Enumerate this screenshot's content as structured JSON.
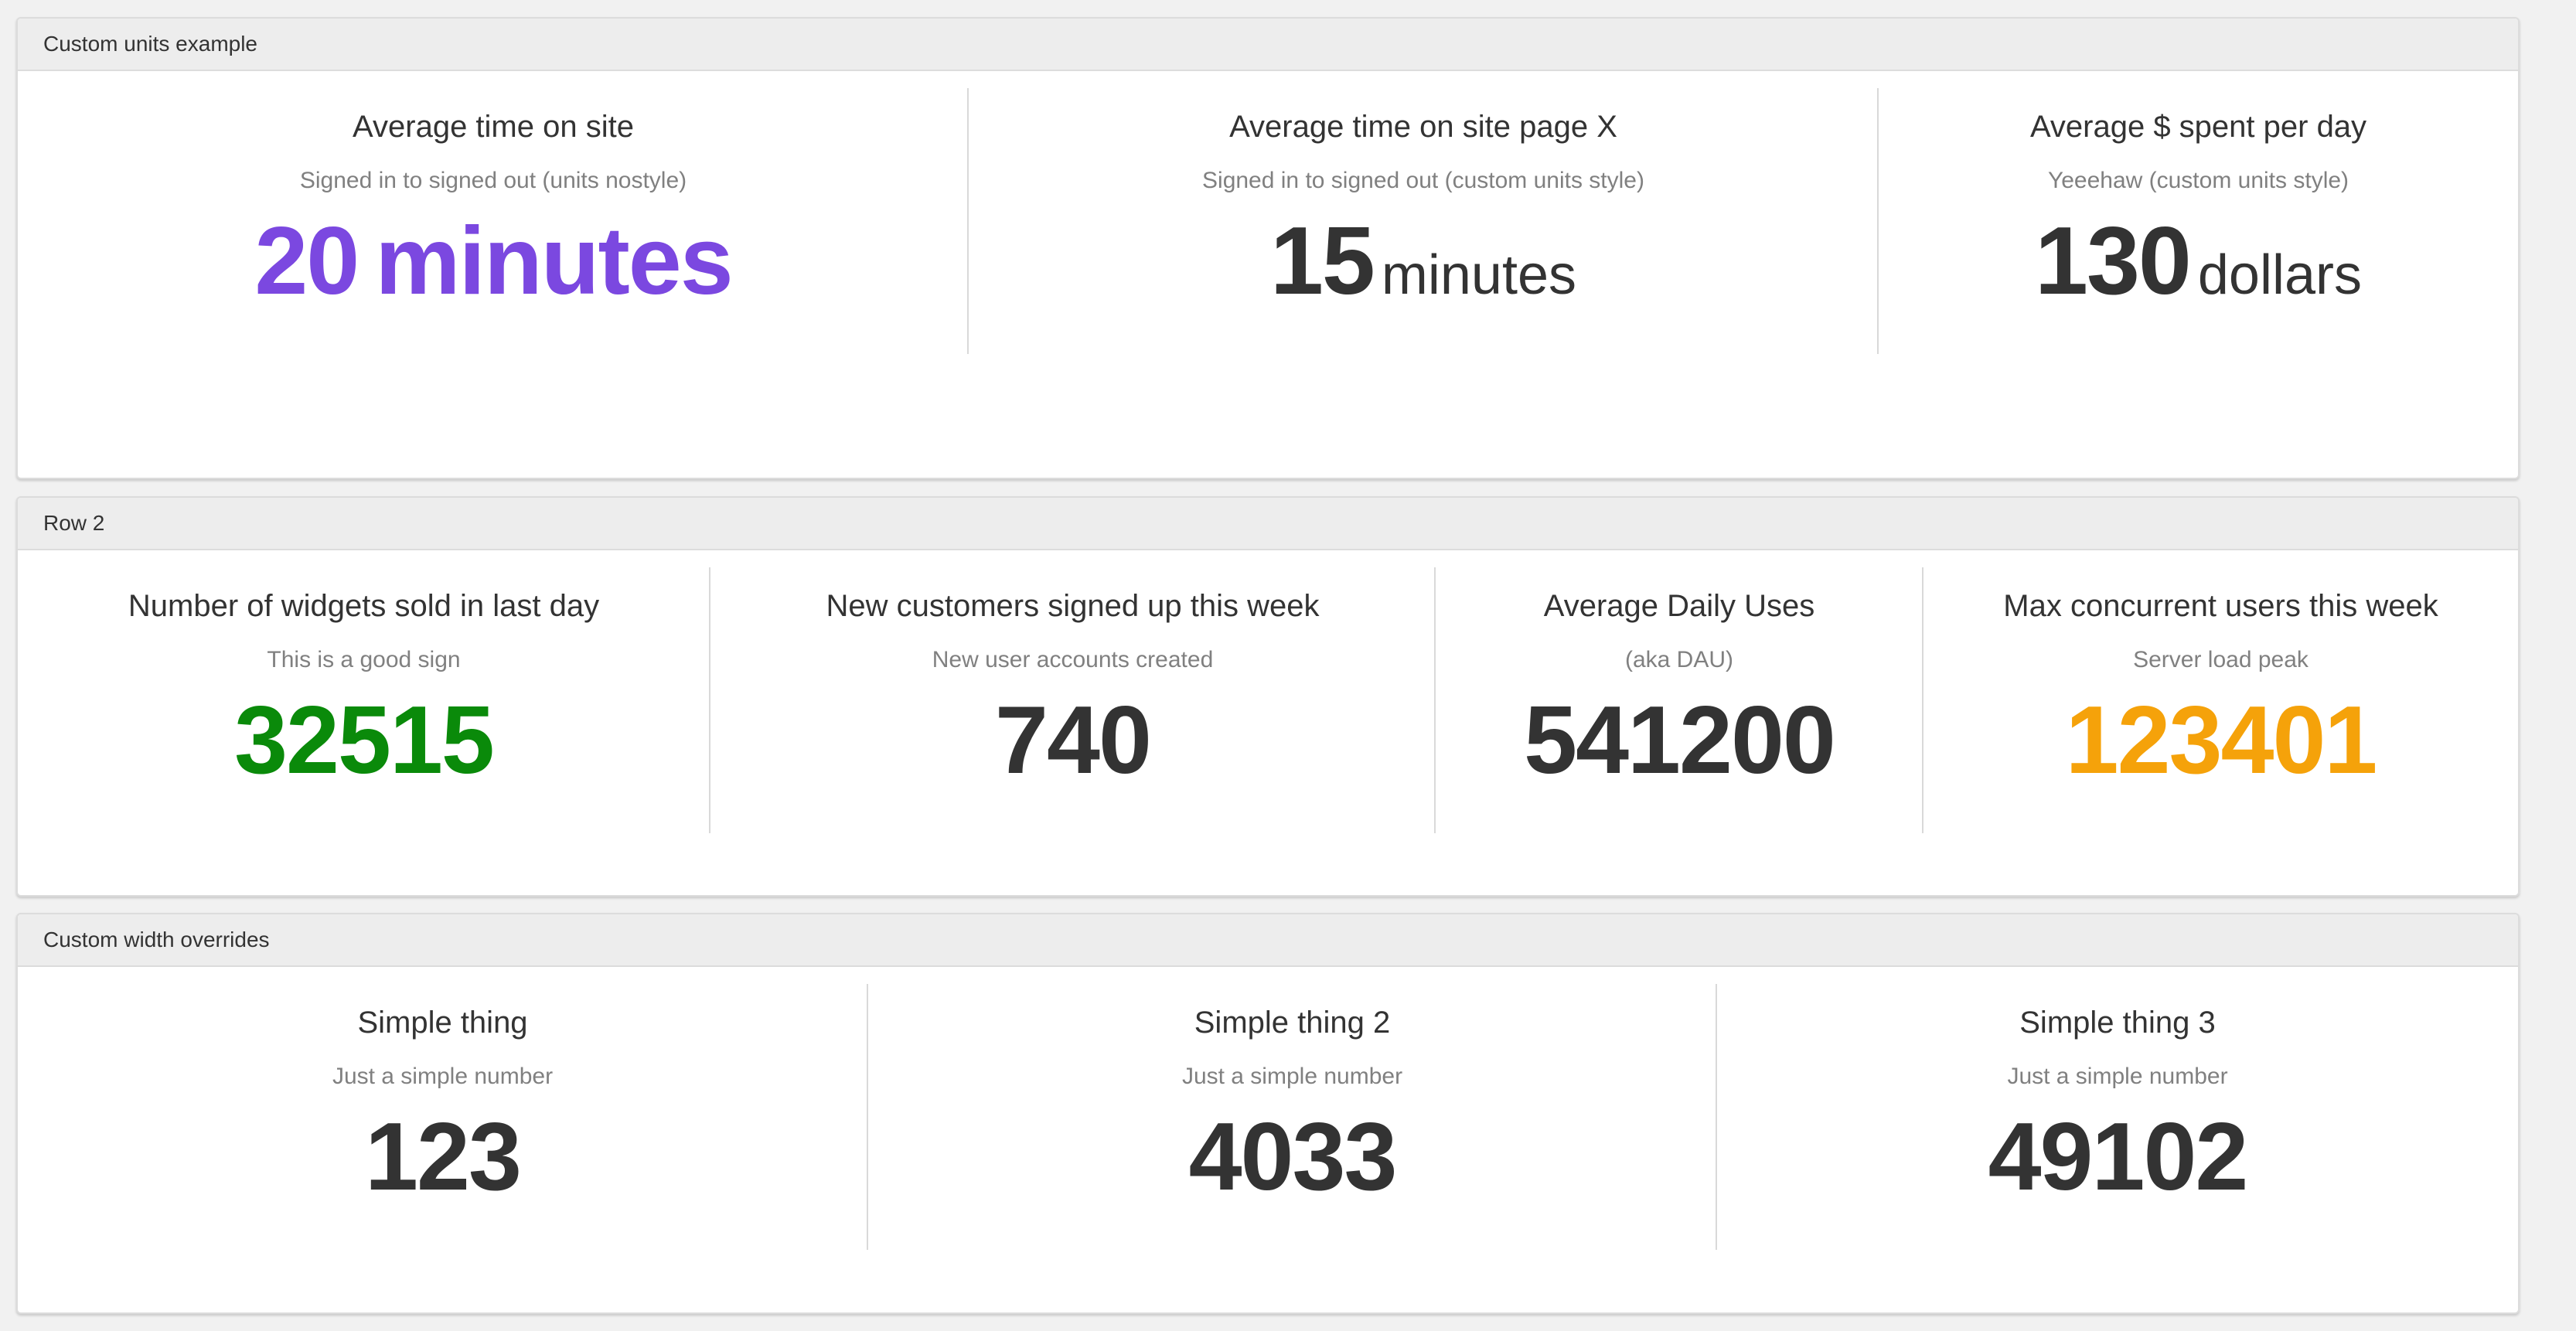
{
  "panels": [
    {
      "title": "Custom units example",
      "widgets": [
        {
          "title": "Average time on site",
          "subtitle": "Signed in to signed out (units nostyle)",
          "value": "20",
          "units": "minutes",
          "color": "#7b48e0"
        },
        {
          "title": "Average time on site page X",
          "subtitle": "Signed in to signed out (custom units style)",
          "value": "15",
          "units": "minutes",
          "color": "#333333"
        },
        {
          "title": "Average $ spent per day",
          "subtitle": "Yeeehaw (custom units style)",
          "value": "130",
          "units": "dollars",
          "color": "#333333"
        }
      ]
    },
    {
      "title": "Row 2",
      "widgets": [
        {
          "title": "Number of widgets sold in last day",
          "subtitle": "This is a good sign",
          "value": "32515",
          "color": "#0a8a0a"
        },
        {
          "title": "New customers signed up this week",
          "subtitle": "New user accounts created",
          "value": "740",
          "color": "#333333"
        },
        {
          "title": "Average Daily Uses",
          "subtitle": "(aka DAU)",
          "value": "541200",
          "color": "#333333"
        },
        {
          "title": "Max concurrent users this week",
          "subtitle": "Server load peak",
          "value": "123401",
          "color": "#f5a20a"
        }
      ]
    },
    {
      "title": "Custom width overrides",
      "widgets": [
        {
          "title": "Simple thing",
          "subtitle": "Just a simple number",
          "value": "123",
          "color": "#333333"
        },
        {
          "title": "Simple thing 2",
          "subtitle": "Just a simple number",
          "value": "4033",
          "color": "#333333"
        },
        {
          "title": "Simple thing 3",
          "subtitle": "Just a simple number",
          "value": "49102",
          "color": "#333333"
        }
      ]
    }
  ]
}
